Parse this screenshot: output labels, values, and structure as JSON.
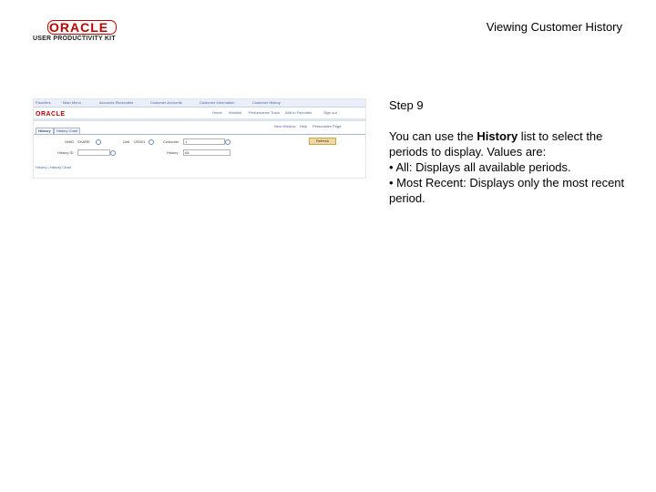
{
  "header": {
    "logo_name": "ORACLE",
    "logo_tagline": "USER PRODUCTIVITY KIT",
    "title": "Viewing Customer History"
  },
  "screenshot": {
    "nav": [
      "Favorites",
      "Main Menu",
      "Accounts Receivable",
      "Customer Accounts",
      "Customer Information",
      "Customer History"
    ],
    "brand": "ORACLE",
    "top_links": [
      "Home",
      "Worklist",
      "Performance Trace",
      "Add to Favorites",
      "Sign out"
    ],
    "page_links": [
      "New Window",
      "Help",
      "Personalize Page"
    ],
    "tabs": [
      "History",
      "History Chart"
    ],
    "fields": {
      "unit_label": "Unit",
      "unit_value": "US001",
      "customer_label": "Customer",
      "customer_value": "1",
      "history_label": "History ID",
      "history_value": "",
      "history_select_label": "History",
      "history_select_value": "All",
      "setid_label": "SetID",
      "setid_value": "SHARE"
    },
    "refresh_button": "Refresh",
    "bottom_link": "History | History Chart"
  },
  "instructions": {
    "step": "Step 9",
    "intro_before": "You can use the ",
    "intro_bold": "History",
    "intro_after": " list to select the periods to display. Values are:",
    "bullet_all": "• All: Displays all available periods.",
    "bullet_recent": "• Most Recent: Displays only the most recent period."
  },
  "colors": {
    "oracle_red": "#c00000",
    "link_blue": "#4a6aa5",
    "button_gold": "#f1d99b"
  }
}
